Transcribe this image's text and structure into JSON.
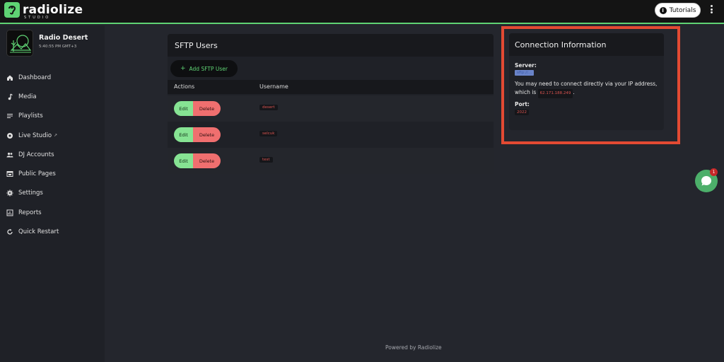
{
  "app": {
    "brand_name": "radiolize",
    "brand_sub": "STUDIO",
    "accent_color": "#5fd374"
  },
  "topbar": {
    "tutorials_label": "Tutorials",
    "tutorials_icon": "info-icon",
    "menu_icon": "kebab-menu-icon"
  },
  "sidebar": {
    "station_name": "Radio Desert",
    "station_time": "5:40:55 PM GMT+3",
    "items": [
      {
        "label": "Dashboard",
        "icon": "home-icon"
      },
      {
        "label": "Media",
        "icon": "music-note-icon"
      },
      {
        "label": "Playlists",
        "icon": "playlist-icon"
      },
      {
        "label": "Live Studio",
        "icon": "record-icon",
        "external": "↗"
      },
      {
        "label": "DJ Accounts",
        "icon": "users-icon"
      },
      {
        "label": "Public Pages",
        "icon": "browser-icon"
      },
      {
        "label": "Settings",
        "icon": "gear-icon"
      },
      {
        "label": "Reports",
        "icon": "chart-icon"
      },
      {
        "label": "Quick Restart",
        "icon": "restart-icon"
      }
    ]
  },
  "sftp": {
    "title": "SFTP Users",
    "add_button": "Add SFTP User",
    "columns": [
      "Actions",
      "Username"
    ],
    "edit_label": "Edit",
    "delete_label": "Delete",
    "users": [
      "desert",
      "selcuk",
      "test"
    ]
  },
  "connection": {
    "title": "Connection Information",
    "server_label": "Server:",
    "server_value": "sftp://...",
    "note_text": "You may need to connect directly via your IP address, which is",
    "ip": "62.171.188.249",
    "note_end": ".",
    "port_label": "Port:",
    "port_value": "2022"
  },
  "chat": {
    "badge": "1"
  },
  "footer": {
    "text": "Powered by Radiolize"
  }
}
